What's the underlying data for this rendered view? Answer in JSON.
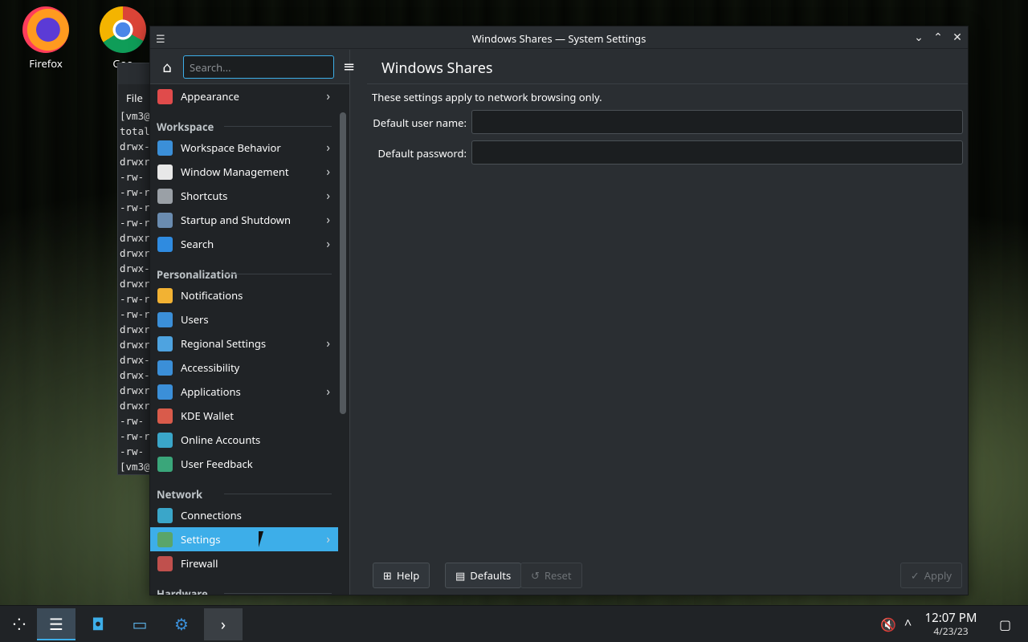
{
  "desktop": {
    "icons": [
      {
        "label": "Firefox",
        "icon": "firefox-icon"
      },
      {
        "label": "Goo",
        "icon": "chrome-icon"
      }
    ]
  },
  "terminal": {
    "menu": "File",
    "lines": [
      "[vm3@",
      "total",
      "drwx-",
      "drwxr",
      "-rw-",
      "-rw-r",
      "-rw-r",
      "-rw-r",
      "drwxr",
      "drwxr",
      "drwx-",
      "drwxr",
      "-rw-r",
      "-rw-r",
      "drwxr",
      "drwxr",
      "drwx-",
      "drwx-",
      "drwxr",
      "drwxr",
      "-rw-",
      "-rw-r",
      "-rw-",
      "[vm3@"
    ]
  },
  "window": {
    "title": "Windows Shares — System Settings",
    "controls": {
      "minimize": "⌄",
      "maximize": "⌃",
      "close": "✕"
    }
  },
  "sidebar": {
    "search_placeholder": "Search...",
    "entries": [
      {
        "type": "item",
        "label": "Appearance",
        "icon": "appearance-icon",
        "chevron": true,
        "color": "#e04b4b"
      },
      {
        "type": "section",
        "label": "Workspace"
      },
      {
        "type": "item",
        "label": "Workspace Behavior",
        "icon": "workspace-behavior-icon",
        "chevron": true,
        "color": "#3b8fd8"
      },
      {
        "type": "item",
        "label": "Window Management",
        "icon": "window-management-icon",
        "chevron": true,
        "color": "#e8e8e8"
      },
      {
        "type": "item",
        "label": "Shortcuts",
        "icon": "keyboard-icon",
        "chevron": true,
        "color": "#9aa0a6"
      },
      {
        "type": "item",
        "label": "Startup and Shutdown",
        "icon": "startup-icon",
        "chevron": true,
        "color": "#6a8cb0"
      },
      {
        "type": "item",
        "label": "Search",
        "icon": "search-icon",
        "chevron": true,
        "color": "#2f8be0"
      },
      {
        "type": "section",
        "label": "Personalization"
      },
      {
        "type": "item",
        "label": "Notifications",
        "icon": "bell-icon",
        "chevron": false,
        "color": "#f2b233"
      },
      {
        "type": "item",
        "label": "Users",
        "icon": "users-icon",
        "chevron": false,
        "color": "#3b8fd8"
      },
      {
        "type": "item",
        "label": "Regional Settings",
        "icon": "regional-icon",
        "chevron": true,
        "color": "#4ea3e0"
      },
      {
        "type": "item",
        "label": "Accessibility",
        "icon": "accessibility-icon",
        "chevron": false,
        "color": "#3b8fd8"
      },
      {
        "type": "item",
        "label": "Applications",
        "icon": "applications-icon",
        "chevron": true,
        "color": "#3b8fd8"
      },
      {
        "type": "item",
        "label": "KDE Wallet",
        "icon": "wallet-icon",
        "chevron": false,
        "color": "#d95b4b"
      },
      {
        "type": "item",
        "label": "Online Accounts",
        "icon": "online-accounts-icon",
        "chevron": false,
        "color": "#3aa6c9"
      },
      {
        "type": "item",
        "label": "User Feedback",
        "icon": "feedback-icon",
        "chevron": false,
        "color": "#3aa67a"
      },
      {
        "type": "section",
        "label": "Network"
      },
      {
        "type": "item",
        "label": "Connections",
        "icon": "globe-icon",
        "chevron": false,
        "color": "#3aa6c9"
      },
      {
        "type": "item",
        "label": "Settings",
        "icon": "network-settings-icon",
        "chevron": true,
        "color": "#5aa56a",
        "active": true
      },
      {
        "type": "item",
        "label": "Firewall",
        "icon": "firewall-icon",
        "chevron": false,
        "color": "#c0504d"
      },
      {
        "type": "section",
        "label": "Hardware"
      }
    ]
  },
  "content": {
    "heading": "Windows Shares",
    "description": "These settings apply to network browsing only.",
    "username_label": "Default user name:",
    "password_label": "Default password:",
    "username_value": "",
    "password_value": ""
  },
  "buttons": {
    "help": "Help",
    "defaults": "Defaults",
    "reset": "Reset",
    "apply": "Apply"
  },
  "taskbar": {
    "time": "12:07 PM",
    "date": "4/23/23"
  },
  "colors": {
    "accent": "#3daee9",
    "window_bg": "#2a2e32",
    "sidebar_bg": "#202326"
  }
}
